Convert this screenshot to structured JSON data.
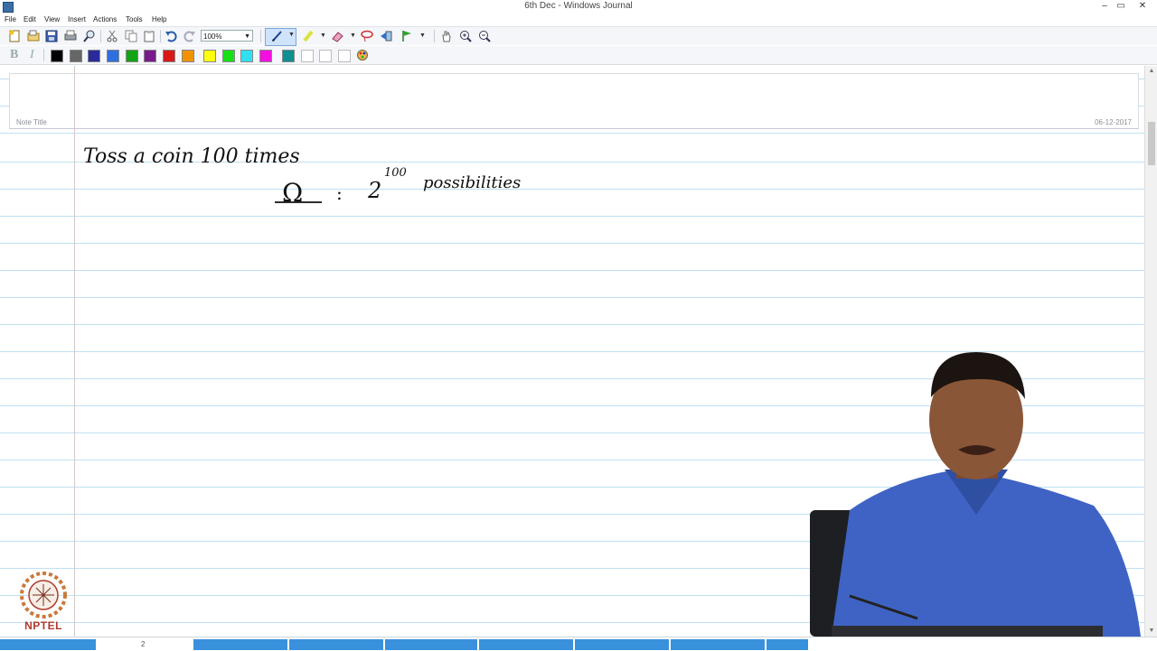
{
  "window": {
    "title": "6th Dec - Windows Journal",
    "minimize": "–",
    "restore": "▭",
    "close": "✕"
  },
  "menu": [
    "File",
    "Edit",
    "View",
    "Insert",
    "Actions",
    "Tools",
    "Help"
  ],
  "toolbar": {
    "zoom": "100%"
  },
  "palette": [
    "#000000",
    "#666666",
    "#2a2a9a",
    "#2f6fe0",
    "#14a314",
    "#7a1a8a",
    "#d81818",
    "#ef9300",
    "#ffff10",
    "#18e018",
    "#30e0f0",
    "#f010e0",
    "#0f8f8f",
    "#ffffff",
    "#ffffff",
    "#ffffff"
  ],
  "note": {
    "title_label": "Note Title",
    "date": "06-12-2017"
  },
  "ink": {
    "line1": "Toss a coin 100 times",
    "omega": "Ω",
    "colon": ":",
    "base": "2",
    "exponent": "100",
    "word": "possibilities"
  },
  "status": {
    "page": "2"
  },
  "watermark": {
    "label": "NPTEL"
  }
}
